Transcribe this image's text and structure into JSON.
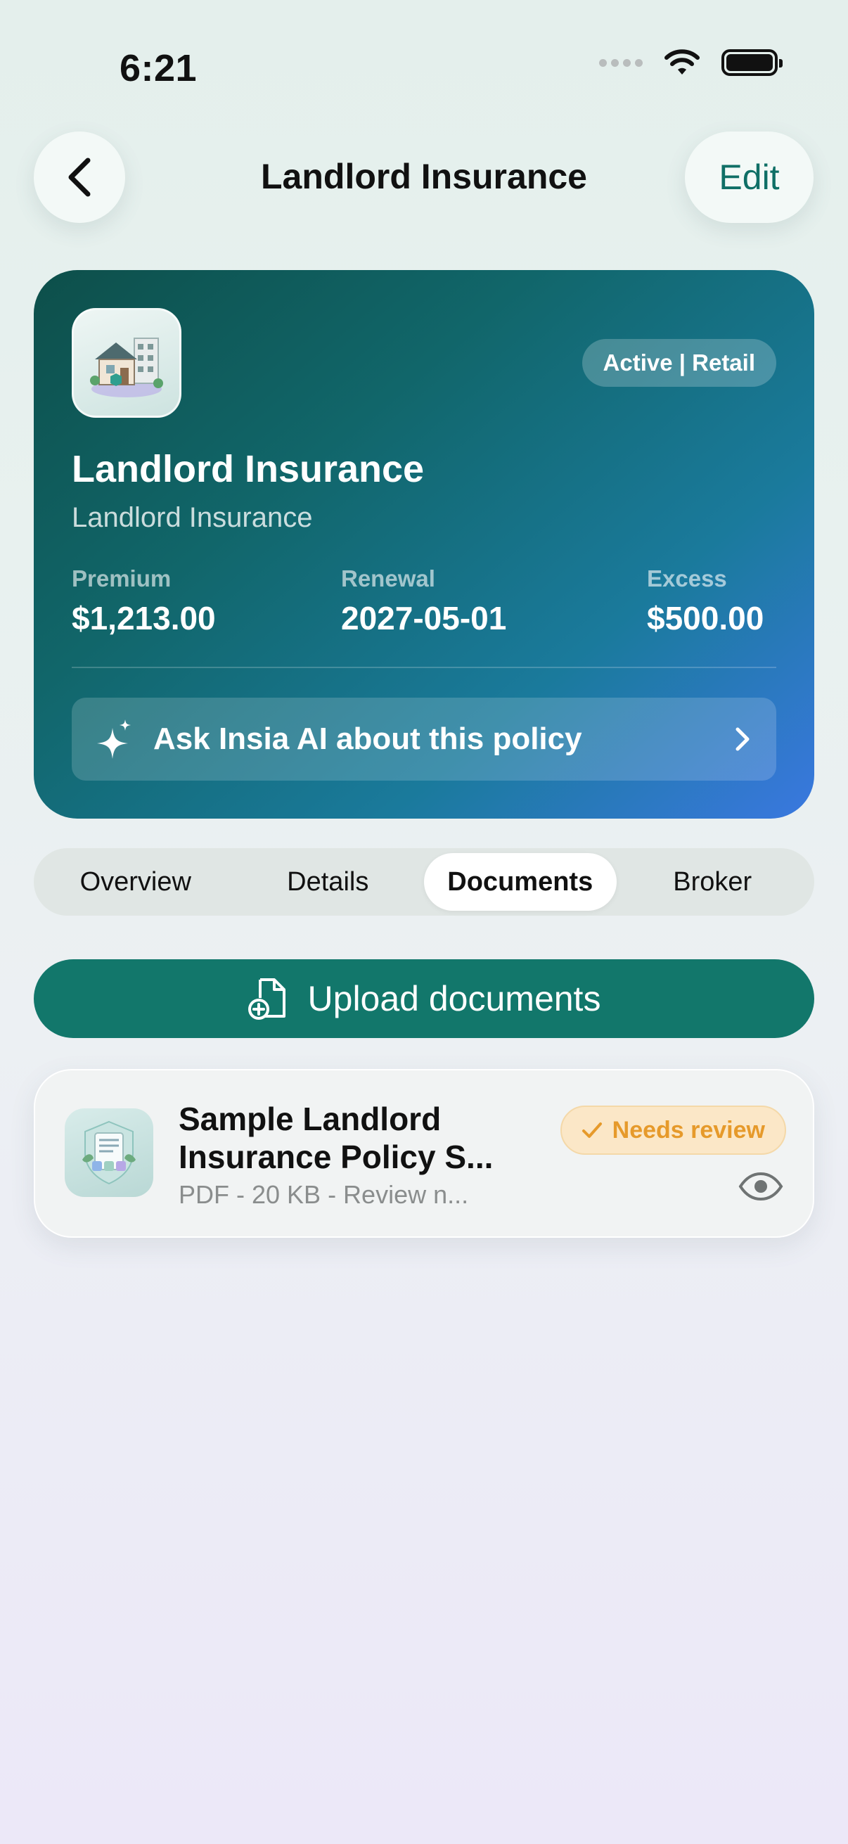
{
  "status_bar": {
    "time": "6:21"
  },
  "nav": {
    "title": "Landlord Insurance",
    "edit_label": "Edit"
  },
  "policy_card": {
    "status": "Active | Retail",
    "title": "Landlord Insurance",
    "subtitle": "Landlord Insurance",
    "premium": {
      "label": "Premium",
      "value": "$1,213.00"
    },
    "renewal": {
      "label": "Renewal",
      "value": "2027-05-01"
    },
    "excess": {
      "label": "Excess",
      "value": "$500.00"
    },
    "ask_ai_label": "Ask Insia AI about this policy"
  },
  "tabs": [
    {
      "label": "Overview"
    },
    {
      "label": "Details"
    },
    {
      "label": "Documents",
      "active": true
    },
    {
      "label": "Broker"
    }
  ],
  "upload_label": "Upload documents",
  "documents": [
    {
      "title": "Sample Landlord Insurance Policy S...",
      "meta": "PDF - 20 KB - Review n...",
      "badge": "Needs review"
    }
  ],
  "colors": {
    "accent": "#12776b",
    "warning": "#e69a2b"
  }
}
